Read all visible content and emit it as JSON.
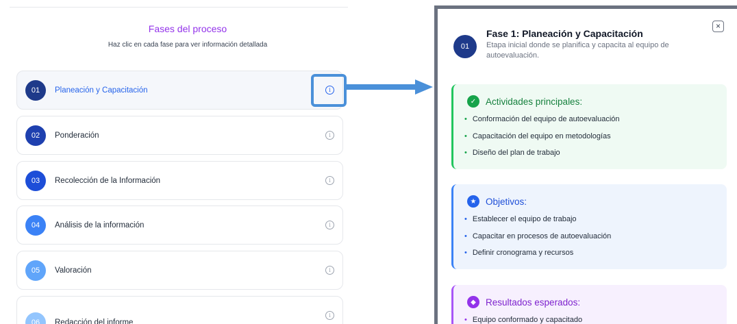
{
  "section": {
    "title": "Fases del proceso",
    "subtitle": "Haz clic en cada fase para ver información detallada"
  },
  "phases": [
    {
      "num": "01",
      "label": "Planeación y Capacitación",
      "color": "#1e3a8a",
      "active": true
    },
    {
      "num": "02",
      "label": "Ponderación",
      "color": "#1e40af"
    },
    {
      "num": "03",
      "label": "Recolección de la Información",
      "color": "#1d4ed8"
    },
    {
      "num": "04",
      "label": "Análisis de la información",
      "color": "#3b82f6"
    },
    {
      "num": "05",
      "label": "Valoración",
      "color": "#60a5fa"
    },
    {
      "num": "06",
      "label": "Redacción del informe",
      "color": "#93c5fd"
    }
  ],
  "info_icon": "info-icon",
  "detail": {
    "num": "01",
    "title": "Fase 1: Planeación y Capacitación",
    "description": "Etapa inicial donde se planifica y capacita al equipo de autoevaluación.",
    "close_icon": "close-icon",
    "sections": [
      {
        "title": "Actividades principales:",
        "icon": "check-icon",
        "items": [
          "Conformación del equipo de autoevaluación",
          "Capacitación del equipo en metodologías",
          "Diseño del plan de trabajo"
        ]
      },
      {
        "title": "Objetivos:",
        "icon": "star-icon",
        "items": [
          "Establecer el equipo de trabajo",
          "Capacitar en procesos de autoevaluación",
          "Definir cronograma y recursos"
        ]
      },
      {
        "title": "Resultados esperados:",
        "icon": "diamond-icon",
        "items": [
          "Equipo conformado y capacitado"
        ]
      }
    ]
  },
  "colors": {
    "accent_purple": "#9333ea",
    "accent_blue": "#2563eb",
    "highlight": "#4a90d9"
  }
}
